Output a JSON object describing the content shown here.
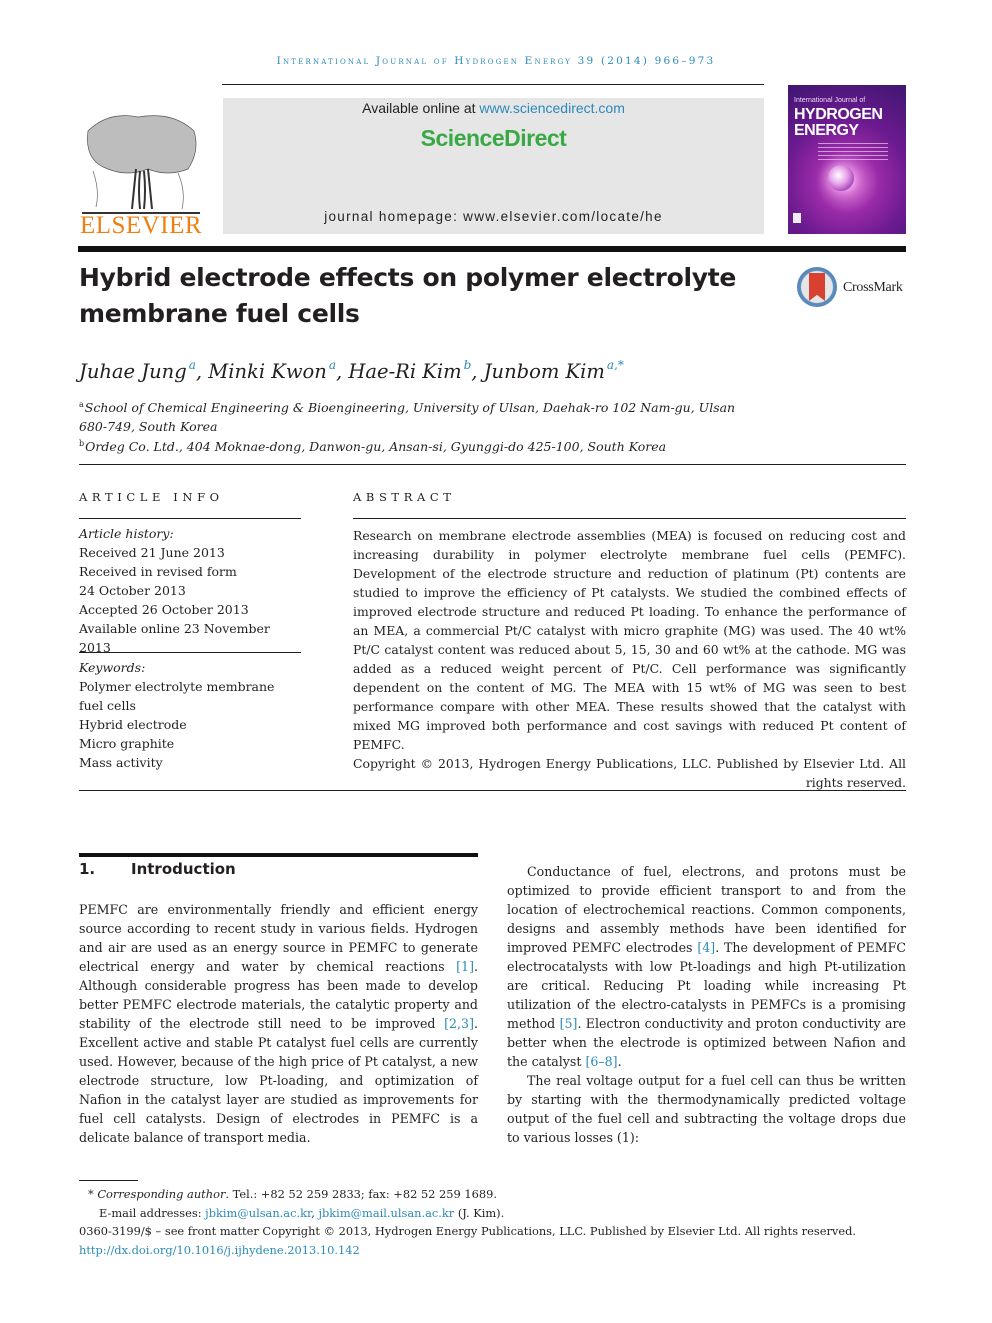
{
  "header": {
    "running_head": "International Journal of Hydrogen Energy 39 (2014) 966–973",
    "publisher_logo_text": "ELSEVIER",
    "available_online_prefix": "Available online at ",
    "available_online_link": "www.sciencedirect.com",
    "brand": "ScienceDirect",
    "journal_homepage": "journal homepage: www.elsevier.com/locate/he",
    "cover": {
      "line1": "International Journal of",
      "line2": "HYDROGEN",
      "line3": "ENERGY"
    },
    "crossmark_label": "CrossMark"
  },
  "article": {
    "title": "Hybrid electrode effects on polymer electrolyte membrane fuel cells",
    "authors": [
      {
        "name": "Juhae Jung",
        "affil": "a"
      },
      {
        "name": "Minki Kwon",
        "affil": "a"
      },
      {
        "name": "Hae-Ri Kim",
        "affil": "b"
      },
      {
        "name": "Junbom Kim",
        "affil": "a,*"
      }
    ],
    "affiliations": [
      {
        "key": "a",
        "text": "School of Chemical Engineering & Bioengineering, University of Ulsan, Daehak-ro 102 Nam-gu, Ulsan 680-749, South Korea"
      },
      {
        "key": "b",
        "text": "Ordeg Co. Ltd., 404 Moknae-dong, Danwon-gu, Ansan-si, Gyunggi-do 425-100, South Korea"
      }
    ]
  },
  "article_info": {
    "heading": "ARTICLE INFO",
    "history_label": "Article history:",
    "history": [
      "Received 21 June 2013",
      "Received in revised form",
      "24 October 2013",
      "Accepted 26 October 2013",
      "Available online 23 November 2013"
    ],
    "keywords_label": "Keywords:",
    "keywords": [
      "Polymer electrolyte membrane fuel cells",
      "Hybrid electrode",
      "Micro graphite",
      "Mass activity"
    ]
  },
  "abstract": {
    "heading": "ABSTRACT",
    "text": "Research on membrane electrode assemblies (MEA) is focused on reducing cost and increasing durability in polymer electrolyte membrane fuel cells (PEMFC). Development of the electrode structure and reduction of platinum (Pt) contents are studied to improve the efficiency of Pt catalysts. We studied the combined effects of improved electrode structure and reduced Pt loading. To enhance the performance of an MEA, a commercial Pt/C catalyst with micro graphite (MG) was used. The 40 wt% Pt/C catalyst content was reduced about 5, 15, 30 and 60 wt% at the cathode. MG was added as a reduced weight percent of Pt/C. Cell performance was significantly dependent on the content of MG. The MEA with 15 wt% of MG was seen to best performance compare with other MEA. These results showed that the catalyst with mixed MG improved both performance and cost savings with reduced Pt content of PEMFC.",
    "copyright": "Copyright © 2013, Hydrogen Energy Publications, LLC. Published by Elsevier Ltd. All rights reserved."
  },
  "introduction": {
    "number": "1.",
    "heading": "Introduction",
    "left_column": {
      "p1_parts": [
        "PEMFC are environmentally friendly and efficient energy source according to recent study in various fields. Hydrogen and air are used as an energy source in PEMFC to generate electrical energy and water by chemical reactions ",
        "[1]",
        ". Although considerable progress has been made to develop better PEMFC electrode materials, the catalytic property and stability of the electrode still need to be improved ",
        "[2,3]",
        ". Excellent active and stable Pt catalyst fuel cells are currently used. However, because of the high price of Pt catalyst, a new electrode structure, low Pt-loading, and optimization of Nafion in the catalyst layer are studied as improvements for fuel cell catalysts. Design of electrodes in PEMFC is a delicate balance of transport media."
      ]
    },
    "right_column": {
      "p1_parts": [
        "Conductance of fuel, electrons, and protons must be optimized to provide efficient transport to and from the location of electrochemical reactions. Common components, designs and assembly methods have been identified for improved PEMFC electrodes ",
        "[4]",
        ". The development of PEMFC electrocatalysts with low Pt-loadings and high Pt-utilization are critical. Reducing Pt loading while increasing Pt utilization of the electro-catalysts in PEMFCs is a promising method ",
        "[5]",
        ". Electron conductivity and proton conductivity are better when the electrode is optimized between Nafion and the catalyst ",
        "[6–8]",
        "."
      ],
      "p2": "The real voltage output for a fuel cell can thus be written by starting with the thermodynamically predicted voltage output of the fuel cell and subtracting the voltage drops due to various losses (1):"
    }
  },
  "footnotes": {
    "corresponding_label": "Corresponding author",
    "corresponding_contact": ". Tel.: +82 52 259 2833; fax: +82 52 259 1689.",
    "email_label": "E-mail addresses: ",
    "emails": [
      "jbkim@ulsan.ac.kr",
      "jbkim@mail.ulsan.ac.kr"
    ],
    "email_suffix": " (J. Kim).",
    "issn_line": "0360-3199/$ – see front matter Copyright © 2013, Hydrogen Energy Publications, LLC. Published by Elsevier Ltd. All rights reserved.",
    "doi": "http://dx.doi.org/10.1016/j.ijhydene.2013.10.142"
  }
}
